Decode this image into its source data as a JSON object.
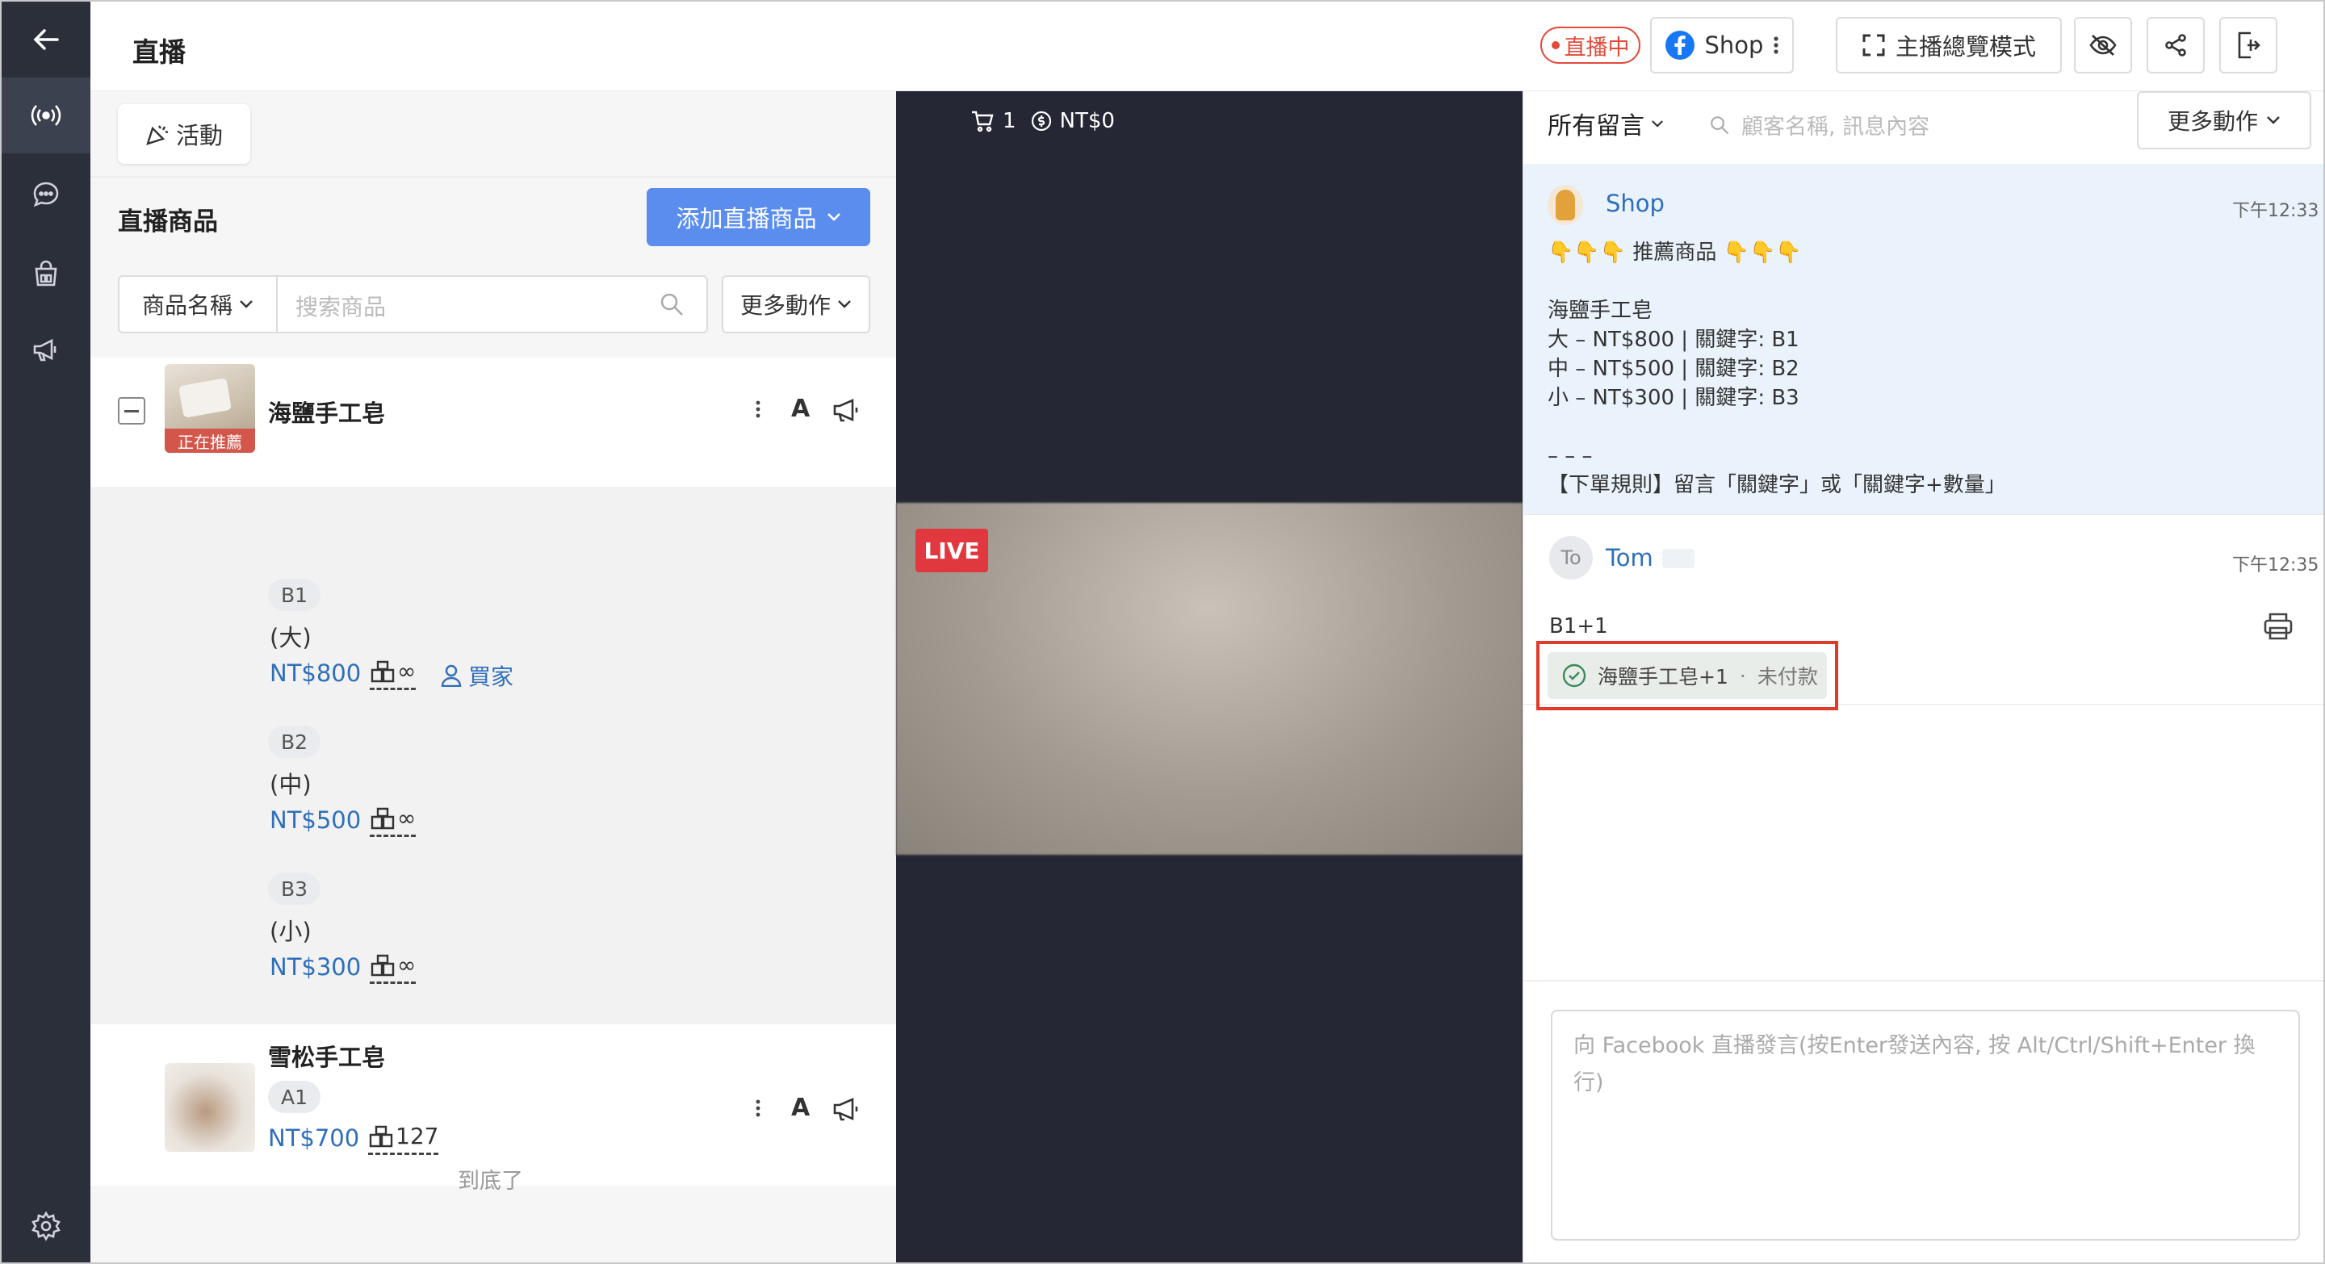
{
  "header": {
    "title": "直播",
    "live_status": "直播中",
    "page_name": "Shop",
    "host_mode_label": "主播總覽模式"
  },
  "left_nav": {
    "icons": [
      "back-arrow-icon",
      "broadcast-icon",
      "chat-icon",
      "shop-icon",
      "megaphone-icon",
      "settings-icon"
    ]
  },
  "products": {
    "activity_label": "活動",
    "section_title": "直播商品",
    "add_button": "添加直播商品",
    "filter_select": "商品名稱",
    "search_placeholder": "搜索商品",
    "more_actions": "更多動作",
    "items": [
      {
        "name": "海鹽手工皂",
        "tag": "正在推薦",
        "variants": [
          {
            "keyword": "B1",
            "size": "(大)",
            "price": "NT$800",
            "stock": "∞",
            "buyer_label": "買家"
          },
          {
            "keyword": "B2",
            "size": "(中)",
            "price": "NT$500",
            "stock": "∞"
          },
          {
            "keyword": "B3",
            "size": "(小)",
            "price": "NT$300",
            "stock": "∞"
          }
        ]
      },
      {
        "name": "雪松手工皂",
        "keyword": "A1",
        "price": "NT$700",
        "stock": "127"
      }
    ],
    "end_text": "到底了"
  },
  "video": {
    "cart_count": "1",
    "total": "NT$0",
    "live_badge": "LIVE"
  },
  "comments": {
    "filter": "所有留言",
    "search_placeholder": "顧客名稱, 訊息內容",
    "more_actions": "更多動作",
    "messages": [
      {
        "user": "Shop",
        "time": "下午12:33",
        "lines": [
          "👇👇👇 推薦商品 👇👇👇",
          "",
          "海鹽手工皂",
          "大 – NT$800 | 關鍵字: B1",
          "中 – NT$500 | 關鍵字: B2",
          "小 – NT$300 | 關鍵字: B3",
          "",
          "– – –",
          "【下單規則】留言「關鍵字」或「關鍵字+數量」"
        ]
      },
      {
        "user": "Tom",
        "avatar_text": "To",
        "time": "下午12:35",
        "text": "B1+1",
        "order_item": "海鹽手工皂+1",
        "order_status": "未付款"
      }
    ],
    "input_placeholder": "向 Facebook 直播發言(按Enter發送內容, 按 Alt/Ctrl/Shift+Enter 換行)"
  },
  "colors": {
    "accent": "#5b8def",
    "live_red": "#e24a3b",
    "highlight_box": "#e03a2a",
    "nav_bg": "#2b2f3a",
    "link": "#2f6fba"
  }
}
